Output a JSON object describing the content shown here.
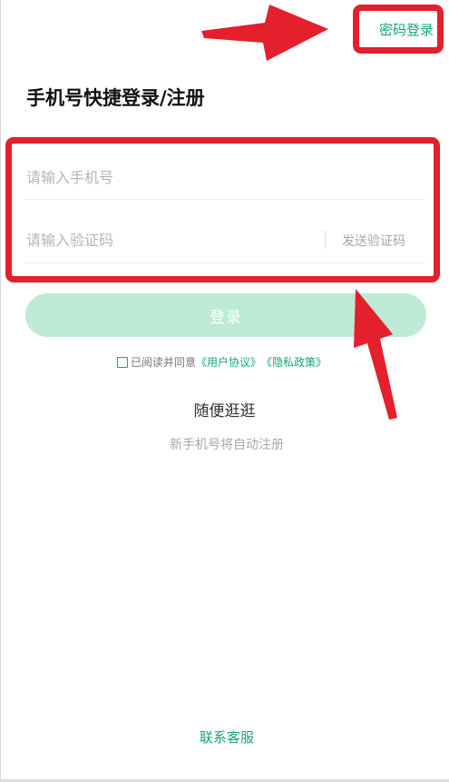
{
  "header": {
    "password_login_label": "密码登录"
  },
  "title": "手机号快捷登录/注册",
  "form": {
    "phone_placeholder": "请输入手机号",
    "code_placeholder": "请输入验证码",
    "send_code_label": "发送验证码",
    "login_label": "登录"
  },
  "agreement": {
    "prefix": "已阅读并同意",
    "user_agreement": "《用户协议》",
    "privacy_policy": "《隐私政策》",
    "checked": false
  },
  "browse_label": "随便逛逛",
  "auto_register_hint": "新手机号将自动注册",
  "contact_label": "联系客服",
  "colors": {
    "accent": "#1aa56a",
    "login_button_disabled": "#bfead5",
    "annotation": "#e3202b"
  },
  "icons": {
    "checkbox": "checkbox-unchecked-icon",
    "annotation_arrow": "arrow-icon"
  }
}
